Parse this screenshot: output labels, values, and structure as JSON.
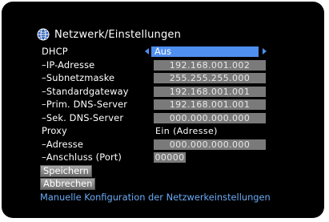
{
  "screen": {
    "title": "Netzwerk/Einstellungen",
    "settings": [
      {
        "label": "DHCP",
        "value": "Aus"
      },
      {
        "label": "–IP-Adresse",
        "value": "192.168.001.002"
      },
      {
        "label": "–Subnetzmaske",
        "value": "255.255.255.000"
      },
      {
        "label": "–Standardgateway",
        "value": "192.168.001.001"
      },
      {
        "label": "–Prim. DNS-Server",
        "value": "192.168.001.001"
      },
      {
        "label": "–Sek. DNS-Server",
        "value": "000.000.000.000"
      },
      {
        "label": "Proxy",
        "value": "Ein (Adresse)"
      },
      {
        "label": "–Adresse",
        "value": "000.000.000.000"
      },
      {
        "label": "–Anschluss (Port)",
        "value": "00000"
      }
    ],
    "buttons": {
      "save": "Speichern",
      "cancel": "Abbrechen"
    },
    "help_text": "Manuelle Konfiguration der Netzwerkeinstellungen",
    "colors": {
      "highlight": "#4f8ff0",
      "field_bg": "#7a7a7a",
      "help_text": "#6aaaf5"
    }
  },
  "icons": {
    "globe": "globe-icon",
    "left_arrow": "arrow-left-icon",
    "right_arrow": "arrow-right-icon"
  }
}
